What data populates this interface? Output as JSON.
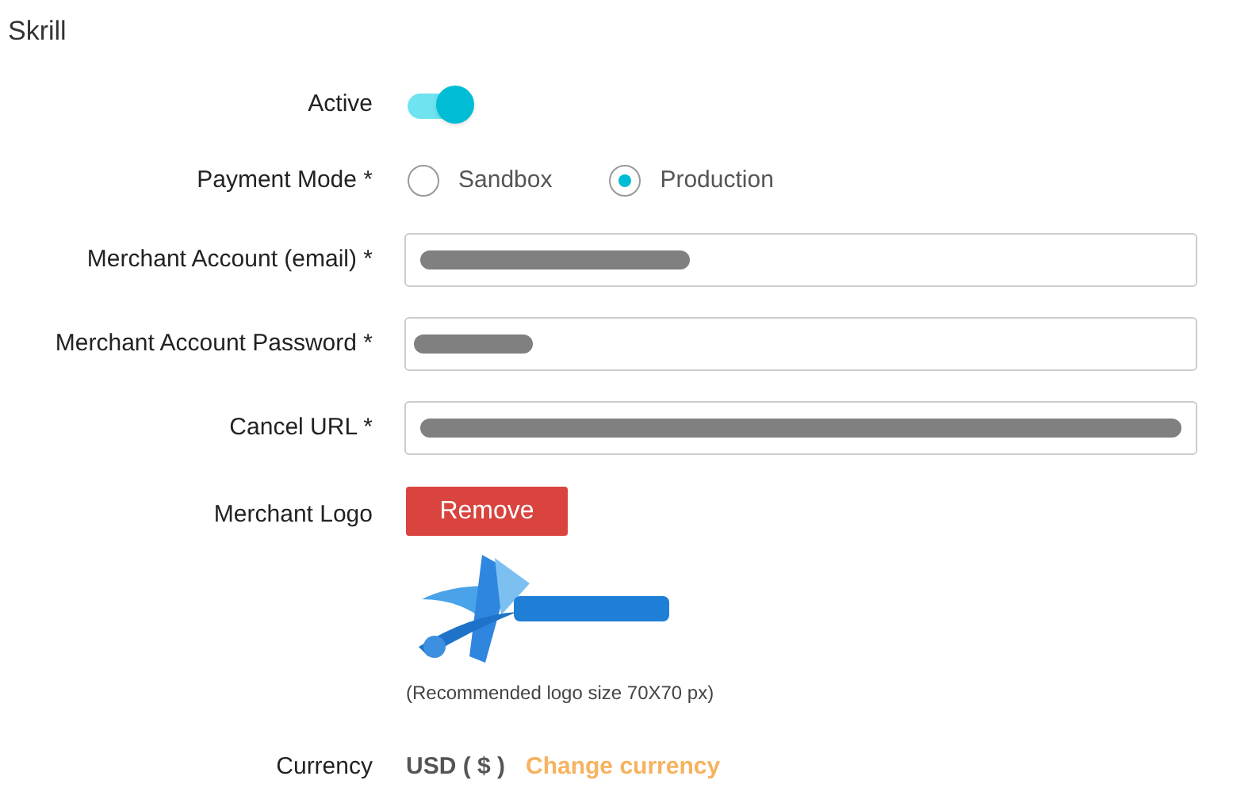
{
  "title": "Skrill",
  "active": {
    "label": "Active",
    "on": true
  },
  "payment_mode": {
    "label": "Payment Mode *",
    "options": [
      {
        "label": "Sandbox",
        "selected": false
      },
      {
        "label": "Production",
        "selected": true
      }
    ]
  },
  "fields": [
    {
      "label": "Merchant Account (email) *",
      "redacted": true
    },
    {
      "label": "Merchant Account Password *",
      "redacted": true
    },
    {
      "label": "Cancel URL *",
      "redacted": true
    }
  ],
  "logo": {
    "label": "Merchant Logo",
    "button": "Remove",
    "hint": "(Recommended logo size 70X70 px)"
  },
  "currency": {
    "label": "Currency",
    "value": "USD ( $ )",
    "link": "Change currency"
  }
}
